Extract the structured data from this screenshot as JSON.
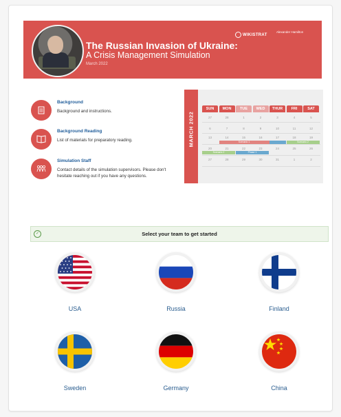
{
  "banner": {
    "title": "The Russian Invasion of Ukraine:",
    "subtitle": "A Crisis Management Simulation",
    "date": "March 2022",
    "logo_primary": "WIKISTRAT",
    "logo_secondary": "Alexander Hamilton"
  },
  "info_items": [
    {
      "title": "Background",
      "description": "Background and instructions.",
      "icon": "document-icon"
    },
    {
      "title": "Background Reading",
      "description": "List of materials for preparatory reading.",
      "icon": "book-icon"
    },
    {
      "title": "Simulation Staff",
      "description": "Contact details of the simulation supervisors. Please don't hesitate reaching out if you have any questions.",
      "icon": "people-icon"
    }
  ],
  "calendar": {
    "month_label": "MARCH 2022",
    "day_headers": [
      "SUN",
      "MON",
      "TUE",
      "WED",
      "THUR",
      "FRI",
      "SAT"
    ],
    "weeks": [
      [
        "27",
        "28",
        "1",
        "2",
        "3",
        "4",
        "5"
      ],
      [
        "6",
        "7",
        "8",
        "9",
        "10",
        "11",
        "12"
      ],
      [
        "13",
        "14",
        "15",
        "16",
        "17",
        "18",
        "19"
      ],
      [
        "20",
        "21",
        "22",
        "23",
        "24",
        "25",
        "26"
      ],
      [
        "27",
        "28",
        "29",
        "30",
        "31",
        "1",
        "2"
      ]
    ],
    "events": [
      {
        "label": "Scenario 1",
        "color": "#e2837f"
      },
      {
        "label": "Scenario 2",
        "color": "#a7cf8b"
      },
      {
        "label": "Phase 1",
        "color": "#6aa8cf"
      }
    ]
  },
  "team_prompt": "Select your team to get started",
  "teams": [
    {
      "name": "USA",
      "flag": "usa-flag-icon"
    },
    {
      "name": "Russia",
      "flag": "russia-flag-icon"
    },
    {
      "name": "Finland",
      "flag": "finland-flag-icon"
    },
    {
      "name": "Sweden",
      "flag": "sweden-flag-icon"
    },
    {
      "name": "Germany",
      "flag": "germany-flag-icon"
    },
    {
      "name": "China",
      "flag": "china-flag-icon"
    }
  ],
  "colors": {
    "accent": "#d9534f",
    "link": "#2a5d8f",
    "success_bg": "#eef5ea"
  }
}
